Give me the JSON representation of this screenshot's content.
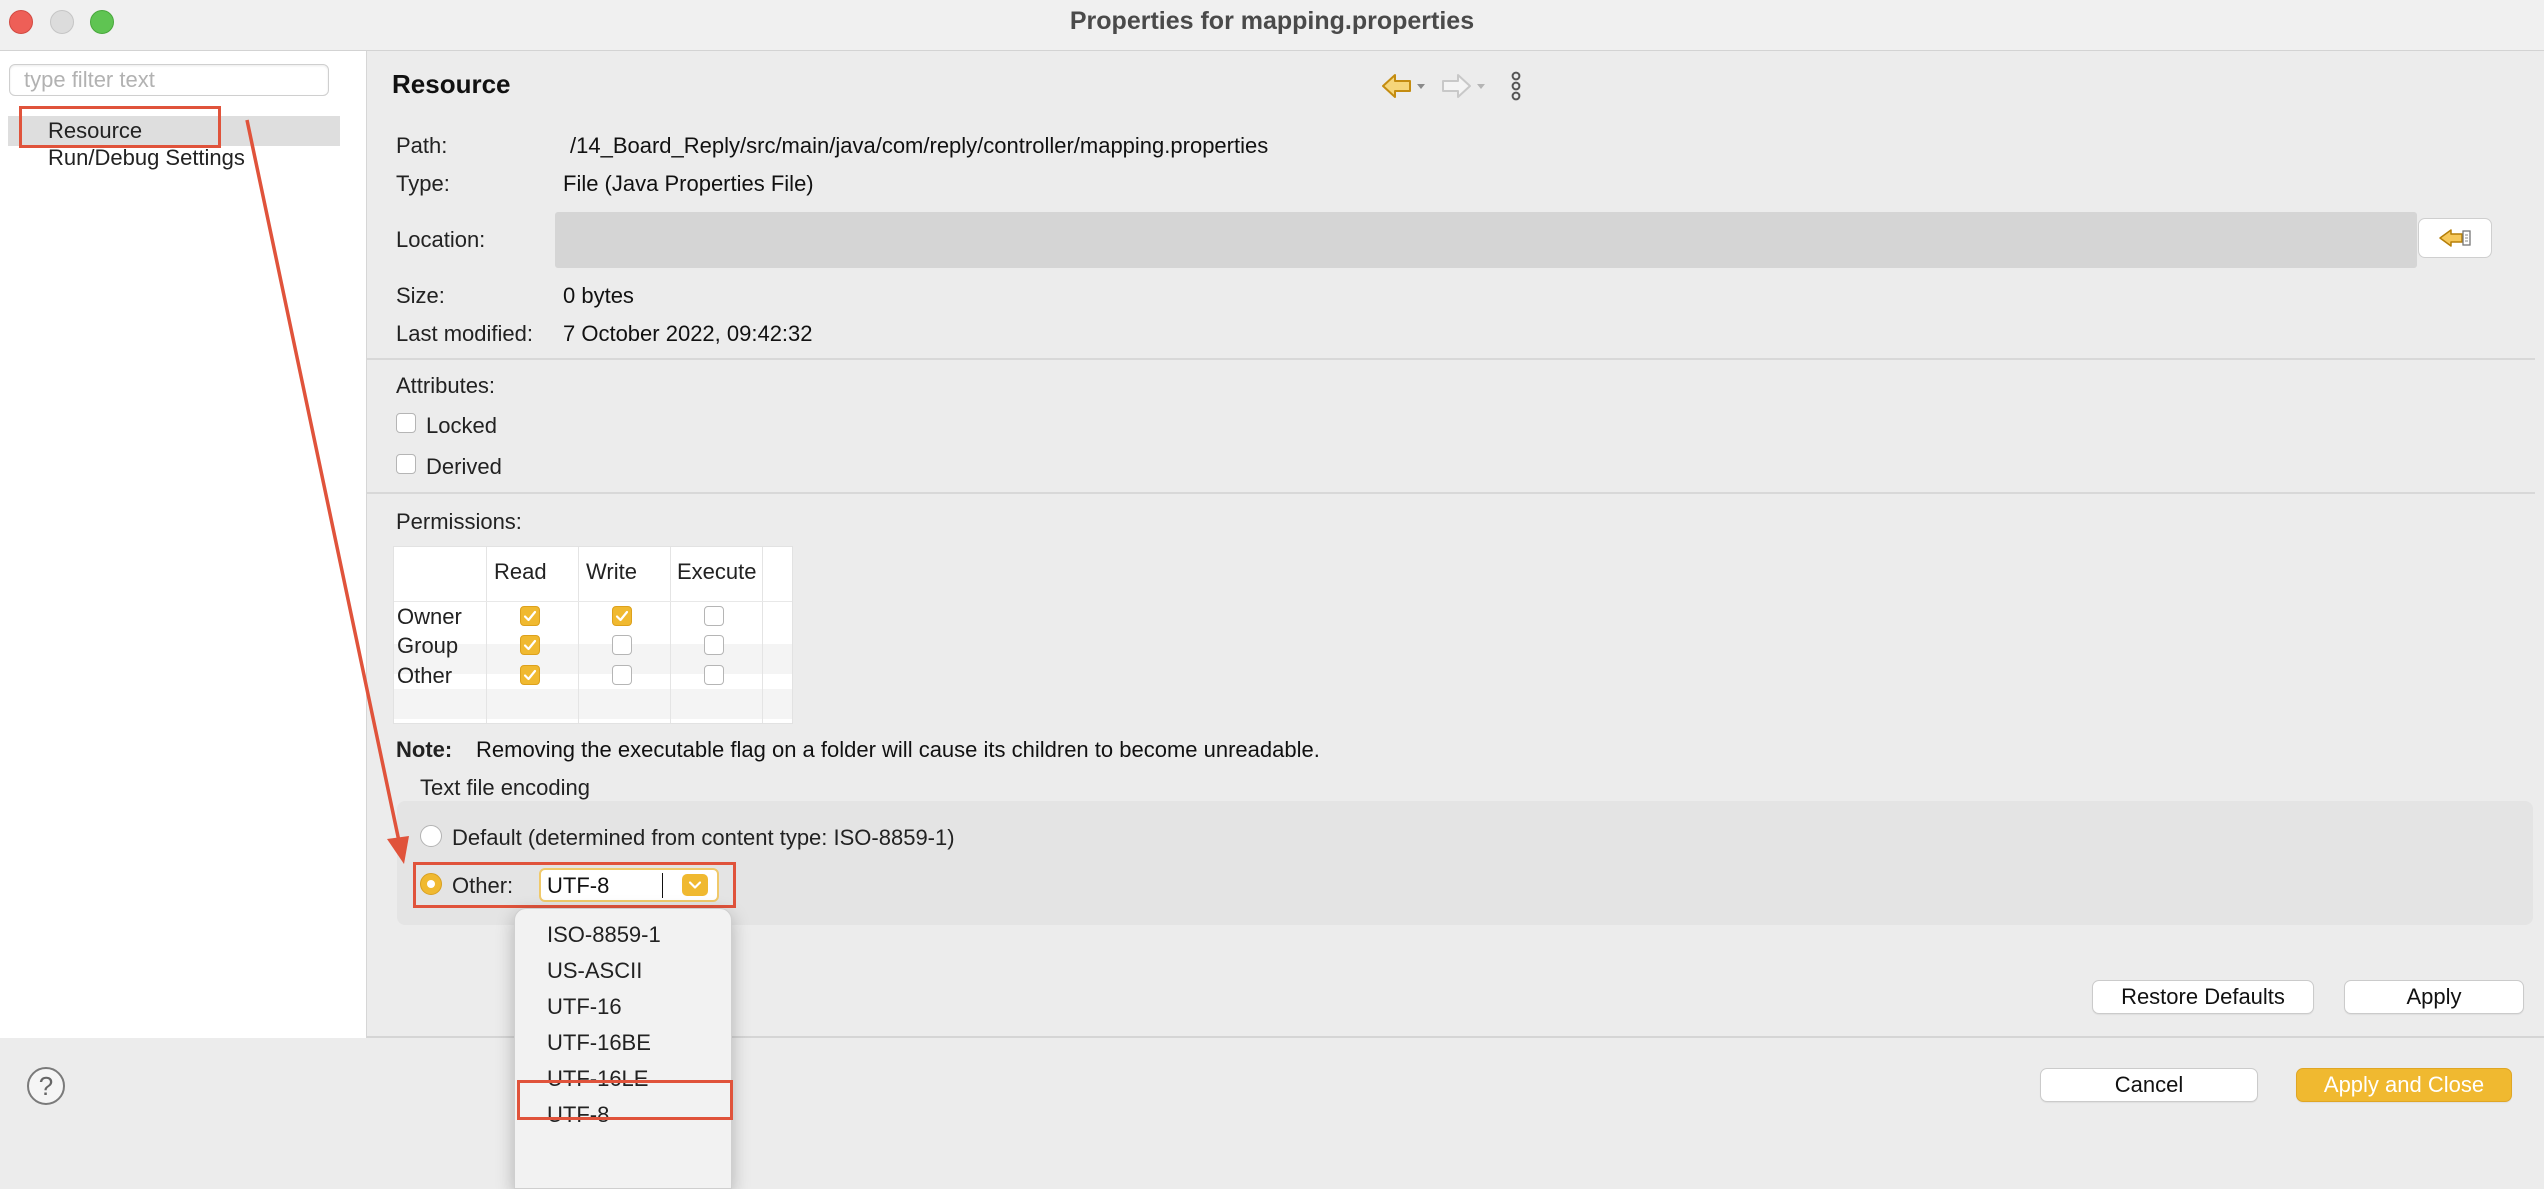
{
  "window": {
    "title": "Properties for mapping.properties"
  },
  "sidebar": {
    "filter_placeholder": "type filter text",
    "items": [
      {
        "label": "Resource"
      },
      {
        "label": "Run/Debug Settings"
      }
    ]
  },
  "main": {
    "page_title": "Resource",
    "path_label": "Path:",
    "path_value": "/14_Board_Reply/src/main/java/com/reply/controller/mapping.properties",
    "type_label": "Type:",
    "type_value": "File  (Java Properties File)",
    "location_label": "Location:",
    "location_value": "",
    "size_label": "Size:",
    "size_value": "0  bytes",
    "modified_label": "Last modified:",
    "modified_value": "7 October 2022, 09:42:32",
    "attributes_label": "Attributes:",
    "locked_label": "Locked",
    "locked_checked": false,
    "derived_label": "Derived",
    "derived_checked": false,
    "permissions_label": "Permissions:",
    "permissions": {
      "columns": [
        "Read",
        "Write",
        "Execute"
      ],
      "rows": [
        {
          "label": "Owner",
          "read": true,
          "write": true,
          "execute": false
        },
        {
          "label": "Group",
          "read": true,
          "write": false,
          "execute": false
        },
        {
          "label": "Other",
          "read": true,
          "write": false,
          "execute": false
        }
      ]
    },
    "note_label": "Note:",
    "note_text": "Removing the executable flag on a folder will cause its children to become unreadable.",
    "encoding": {
      "group_label": "Text file encoding",
      "default_label": "Default (determined from content type: ISO-8859-1)",
      "other_label": "Other:",
      "selected": "other",
      "value": "UTF-8",
      "options": [
        "ISO-8859-1",
        "US-ASCII",
        "UTF-16",
        "UTF-16BE",
        "UTF-16LE",
        "UTF-8"
      ],
      "highlighted_option": "UTF-8"
    },
    "restore_defaults_label": "Restore Defaults",
    "apply_label": "Apply"
  },
  "footer": {
    "help_symbol": "?",
    "cancel_label": "Cancel",
    "apply_close_label": "Apply and Close"
  },
  "colors": {
    "accent": "#f0b930",
    "annotation_red": "#e0533b",
    "selection_bg": "#dedede"
  },
  "icons": {
    "back": "back-arrow-icon",
    "forward": "forward-arrow-icon",
    "menu": "view-menu-icon",
    "location": "show-in-system-explorer-icon"
  }
}
